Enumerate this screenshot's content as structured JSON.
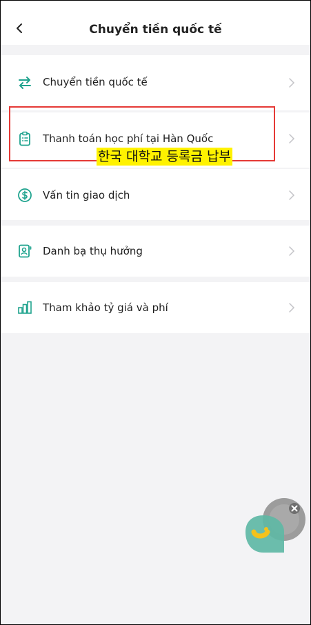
{
  "header": {
    "title": "Chuyển tiền quốc tế",
    "back_icon": "chevron-left-icon"
  },
  "menu": [
    {
      "label": "Chuyển tiền quốc tế",
      "icon": "transfer-arrows-icon"
    },
    {
      "label": "Thanh toán học phí tại Hàn Quốc",
      "icon": "clipboard-icon"
    },
    {
      "label": "Vấn tin giao dịch",
      "icon": "dollar-circle-icon"
    },
    {
      "label": "Danh bạ thụ hưởng",
      "icon": "contact-book-icon"
    },
    {
      "label": "Tham khảo tỷ giá và phí",
      "icon": "bar-chart-icon"
    }
  ],
  "annotation": {
    "caption": "한국 대학교 등록금 납부"
  },
  "colors": {
    "accent": "#1fa38e",
    "highlight_border": "#e53935",
    "caption_bg": "#fff200"
  }
}
